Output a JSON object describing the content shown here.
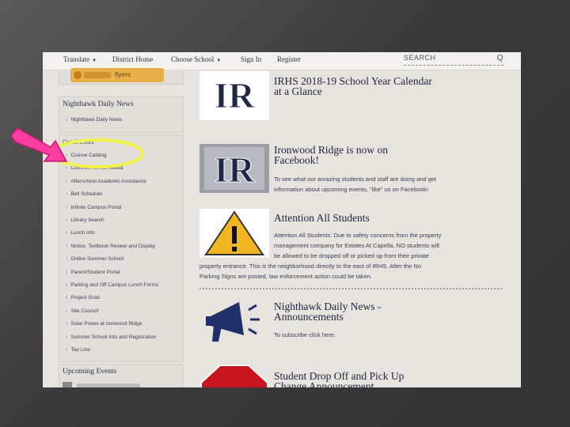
{
  "nav": {
    "translate": "Translate",
    "district_home": "District Home",
    "choose_school": "Choose School",
    "sign_in": "Sign In",
    "register": "Register",
    "search_placeholder": "SEARCH"
  },
  "sidebar": {
    "pixbtn_label": "flyers",
    "news_title": "Nighthawk Daily News",
    "news_link": "Nighthawk Daily News",
    "quick_title": "Quick Links",
    "links": [
      "Course Catalog",
      "Common Sense Media",
      "Afterschool Academic Assistance",
      "Bell Schedule",
      "Infinite Campus Portal",
      "Library Search",
      "Lunch Info",
      "Notice, Textbook Review and Display",
      "Online Summer School",
      "Parent/Student Portal",
      "Parking and Off Campus Lunch Forms",
      "Project Grad",
      "Site Council",
      "Solar Power at Ironwood Ridge",
      "Summer School Info and Registration",
      "Top Line"
    ],
    "upcoming_title": "Upcoming Events"
  },
  "cards": [
    {
      "title_1": "IRHS 2018-19 School Year Calendar",
      "title_2": "at a Glance"
    },
    {
      "title_1": "Ironwood Ridge is now on",
      "title_2": "Facebook!",
      "text_1": "To see what our amazing students and staff are doing and get",
      "text_2": "information about upcoming events, \"like\" us on Facebook!"
    },
    {
      "title_1": "Attention All Students",
      "text_1": "Attention All Students: Due to safety concerns from the property",
      "text_2": "management company for Estates At Capella, NO students will",
      "text_3": "be allowed to be dropped off or picked up from their private",
      "text_4": "property entrance. This is the neighborhood directly to the east of IRHS. After the No",
      "text_5": "Parking Signs are posted, law enforcement action could be taken."
    },
    {
      "title_1": "Nighthawk Daily News -",
      "title_2": "Announcements",
      "text_1": "To subscribe click here."
    },
    {
      "title_1": "Student Drop Off and Pick Up",
      "title_2": "Change Announcement"
    }
  ],
  "logo_text": "IR",
  "colors": {
    "navy": "#1e2746",
    "highlight": "#f2f24a",
    "arrow": "#ff3da0"
  }
}
